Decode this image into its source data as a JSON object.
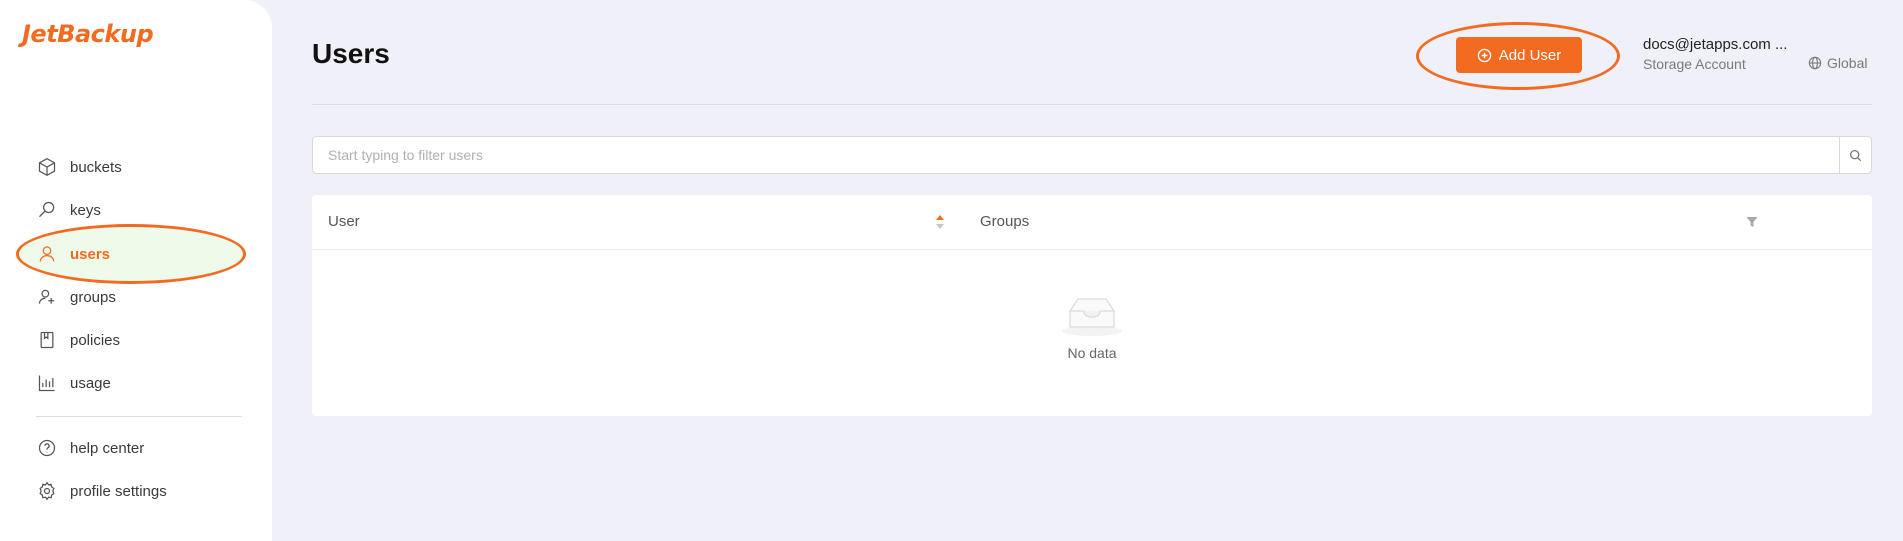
{
  "brand": {
    "logo_text": "JetBackup",
    "accent": "#f26b21"
  },
  "sidebar": {
    "items": [
      {
        "label": "buckets",
        "icon": "box-icon"
      },
      {
        "label": "keys",
        "icon": "key-icon"
      },
      {
        "label": "users",
        "icon": "user-icon",
        "active": true
      },
      {
        "label": "groups",
        "icon": "users-icon"
      },
      {
        "label": "policies",
        "icon": "book-icon"
      },
      {
        "label": "usage",
        "icon": "bar-chart-icon"
      }
    ],
    "bottom_items": [
      {
        "label": "help center",
        "icon": "help-icon"
      },
      {
        "label": "profile settings",
        "icon": "gear-icon"
      }
    ]
  },
  "header": {
    "title": "Users",
    "add_button_label": "Add User",
    "account_email": "docs@jetapps.com ...",
    "account_type": "Storage Account",
    "region": "Global"
  },
  "search": {
    "placeholder": "Start typing to filter users",
    "value": ""
  },
  "table": {
    "columns": [
      "User",
      "Groups"
    ],
    "rows": [],
    "empty_text": "No data"
  }
}
